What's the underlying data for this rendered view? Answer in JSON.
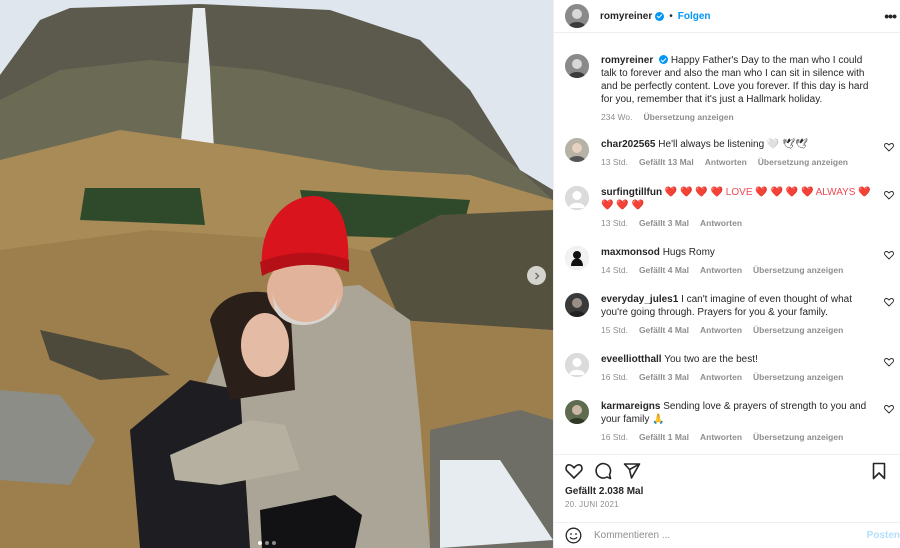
{
  "header": {
    "username": "romyreiner",
    "separator": "•",
    "follow_label": "Folgen",
    "more_label": "•••"
  },
  "caption": {
    "username": "romyreiner",
    "text": "Happy Father's Day to the man who I could talk to forever and also the man who I can sit in silence with and be perfectly content. Love you forever. If this day is hard for you, remember that it's just a Hallmark holiday.",
    "time": "234 Wo.",
    "translate_label": "Übersetzung anzeigen"
  },
  "comments": [
    {
      "username": "char202565",
      "text": "He'll always be listening 🤍 🕊🕊",
      "time": "13 Std.",
      "likes": "Gefällt 13 Mal",
      "reply": "Antworten",
      "translate": "Übersetzung anzeigen"
    },
    {
      "username": "surfingtillfun",
      "text": "❤️ ❤️ ❤️ ❤️ LOVE ❤️ ❤️ ❤️ ❤️ ALWAYS ❤️ ❤️ ❤️ ❤️",
      "time": "13 Std.",
      "likes": "Gefällt 3 Mal",
      "reply": "Antworten",
      "translate": ""
    },
    {
      "username": "maxmonsod",
      "text": "Hugs Romy",
      "time": "14 Std.",
      "likes": "Gefällt 4 Mal",
      "reply": "Antworten",
      "translate": "Übersetzung anzeigen"
    },
    {
      "username": "everyday_jules1",
      "text": "I can't imagine of even thought of what you're going through. Prayers for you & your family.",
      "time": "15 Std.",
      "likes": "Gefällt 4 Mal",
      "reply": "Antworten",
      "translate": "Übersetzung anzeigen"
    },
    {
      "username": "eveelliotthall",
      "text": "You two are the best!",
      "time": "16 Std.",
      "likes": "Gefällt 3 Mal",
      "reply": "Antworten",
      "translate": "Übersetzung anzeigen"
    },
    {
      "username": "karmareigns",
      "text": "Sending love & prayers of strength to you and your family 🙏",
      "time": "16 Std.",
      "likes": "Gefällt 1 Mal",
      "reply": "Antworten",
      "translate": "Übersetzung anzeigen"
    }
  ],
  "post": {
    "likes": "Gefällt 2.038 Mal",
    "date": "20. JUNI 2021"
  },
  "comment_input": {
    "placeholder": "Kommentieren ...",
    "post_label": "Posten"
  },
  "icons": {
    "next": "chevron-right-icon",
    "like": "heart-icon",
    "comment": "comment-bubble-icon",
    "share": "paper-plane-icon",
    "save": "bookmark-icon",
    "emoji": "smiley-icon"
  },
  "colors": {
    "accent": "#0095f6",
    "muted": "#8e8e8e",
    "heart": "#ed4956"
  }
}
